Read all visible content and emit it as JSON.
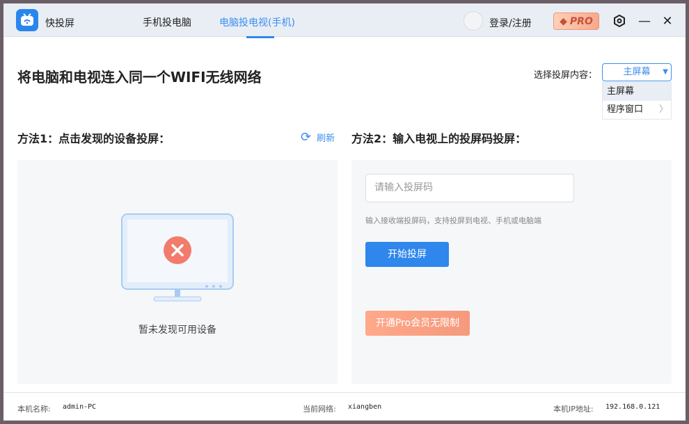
{
  "app": {
    "name": "快投屏"
  },
  "tabs": [
    {
      "label": "手机投电脑"
    },
    {
      "label": "电脑投电视(手机)",
      "active": true
    }
  ],
  "header": {
    "login": "登录/注册",
    "pro": "PRO"
  },
  "main": {
    "title": "将电脑和电视连入同一个WIFI无线网络",
    "select_label": "选择投屏内容：",
    "select_value": "主屏幕",
    "dropdown": [
      {
        "label": "主屏幕"
      },
      {
        "label": "程序窗口"
      }
    ],
    "method1": {
      "title": "方法1：点击发现的设备投屏：",
      "refresh": "刷新",
      "empty": "暂未发现可用设备"
    },
    "method2": {
      "title": "方法2：输入电视上的投屏码投屏：",
      "placeholder": "请输入投屏码",
      "hint": "输入接收端投屏码，支持投屏到电视、手机或电脑端",
      "start": "开始投屏",
      "pro_button": "开通Pro会员无限制"
    }
  },
  "footer": {
    "host_label": "本机名称:",
    "host": "admin-PC",
    "network_label": "当前网络:",
    "network": "xiangben",
    "ip_label": "本机IP地址:",
    "ip": "192.168.0.121"
  },
  "colors": {
    "accent": "#2f86ec",
    "pro": "#f7a98a"
  }
}
